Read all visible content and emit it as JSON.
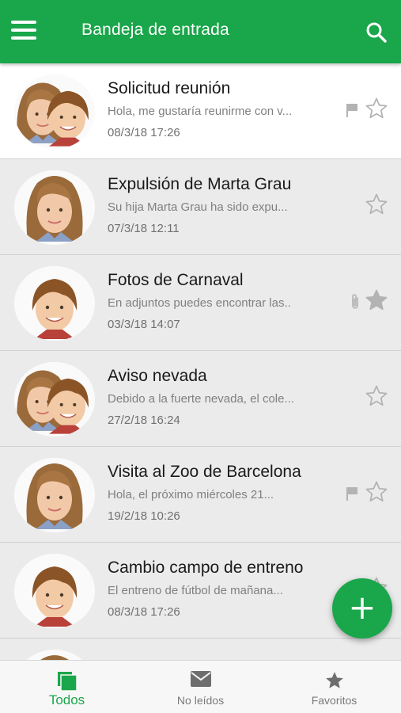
{
  "header": {
    "title": "Bandeja de entrada",
    "menu_icon": "menu-icon",
    "search_icon": "search-icon"
  },
  "colors": {
    "accent": "#1aa64a",
    "unread_bg": "#ebebeb",
    "read_bg": "#ffffff",
    "icon_gray": "#b3b3b3",
    "tab_inactive": "#7a7a7a"
  },
  "emails": [
    {
      "subject": "Solicitud reunión",
      "preview": "Hola, me gustaría reunirme con v...",
      "date": "08/3/18  17:26",
      "avatar": "two-children",
      "read": true,
      "flagged": true,
      "attachment": false,
      "starred": false
    },
    {
      "subject": "Expulsión de Marta Grau",
      "preview": "Su hija Marta Grau ha sido expu...",
      "date": "07/3/18  12:11",
      "avatar": "girl",
      "read": false,
      "flagged": false,
      "attachment": false,
      "starred": false
    },
    {
      "subject": "Fotos de Carnaval",
      "preview": "En adjuntos puedes encontrar las..",
      "date": "03/3/18  14:07",
      "avatar": "boy",
      "read": false,
      "flagged": false,
      "attachment": true,
      "starred": true
    },
    {
      "subject": "Aviso nevada",
      "preview": "Debido a la fuerte nevada, el cole...",
      "date": "27/2/18  16:24",
      "avatar": "two-children",
      "read": false,
      "flagged": false,
      "attachment": false,
      "starred": false
    },
    {
      "subject": "Visita al Zoo de Barcelona",
      "preview": "Hola, el próximo miércoles 21...",
      "date": "19/2/18  10:26",
      "avatar": "girl",
      "read": false,
      "flagged": true,
      "attachment": false,
      "starred": false
    },
    {
      "subject": "Cambio campo de entreno",
      "preview": "El entreno de fútbol de mañana...",
      "date": "08/3/18  17:26",
      "avatar": "boy",
      "read": false,
      "flagged": false,
      "attachment": false,
      "starred": false
    },
    {
      "subject": "",
      "preview": "",
      "date": "",
      "avatar": "girl",
      "read": false,
      "flagged": false,
      "attachment": false,
      "starred": false
    }
  ],
  "fab": {
    "label": "+"
  },
  "bottom_nav": [
    {
      "label": "Todos",
      "icon": "inbox-stack-icon",
      "active": true
    },
    {
      "label": "No leídos",
      "icon": "envelope-icon",
      "active": false
    },
    {
      "label": "Favoritos",
      "icon": "star-icon",
      "active": false
    }
  ]
}
